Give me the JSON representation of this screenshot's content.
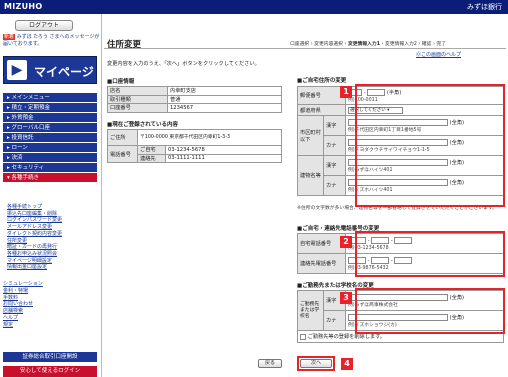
{
  "header": {
    "logo": "MIZUHO",
    "bank_name": "みずほ銀行"
  },
  "sidebar": {
    "logout_label": "ログアウト",
    "new_tag": "新着",
    "new_message": "みずほ たろう さまへのメッセージが届いております。",
    "mypage_label": "マイページ",
    "menu": [
      "メインメニュー",
      "積立・定期預金",
      "外貨預金",
      "グローバル口座",
      "投資信託",
      "ローン",
      "決済",
      "セキュリティ",
      "各種手続き"
    ],
    "submenu": [
      "各種手続トップ",
      "振込先口座編集・削除",
      "ログインパスワード変更",
      "メールアドレス変更",
      "ダイレクト契約内容変更",
      "住所変更",
      "暗証・カードの再発行",
      "各種お申込み状況照会",
      "マイページ明細設定",
      "情報出金口座設定"
    ],
    "extra_links": [
      "シミュレーション",
      "金利・特場",
      "手数料",
      "お問い合わせ",
      "店舗検索",
      "ヘルプ",
      "規定"
    ],
    "securities_button": "証券総合取引口座開設",
    "red_button": "安心して使えるログイン"
  },
  "page": {
    "title": "住所変更",
    "breadcrumbs": [
      "口座選択",
      "変更内容選択",
      "変更情報入力1",
      "変更情報入力2",
      "確認",
      "完了"
    ],
    "help_link": "この画面のヘルプ",
    "intro": "変更内容を入力のうえ、「次へ」ボタンをクリックしてください。"
  },
  "account_info": {
    "heading": "■口座情報",
    "rows": [
      [
        "店名",
        "内幸町支店"
      ],
      [
        "取引種類",
        "普通"
      ],
      [
        "口座番号",
        "1234567"
      ]
    ]
  },
  "current_info": {
    "heading": "■現在ご登録されている内容",
    "address_label": "ご住所",
    "address_value": "〒100-0000 東京都千代田区内幸町1-3-3",
    "phone_label": "電話番号",
    "home_label": "ご自宅",
    "home_value": "03-1234-5678",
    "contact_label": "連絡先",
    "contact_value": "03-1111-1111"
  },
  "form": {
    "address_heading": "■ご自宅住所の変更",
    "postal_label": "郵便番号",
    "postal_halfwidth": "(半角)",
    "postal_example": "例)100-0011",
    "pref_label": "都道府県",
    "pref_select": "選択してください",
    "city_label": "市区町村以下",
    "kanji_label": "漢字",
    "kana_label": "カナ",
    "fullwidth": "(全角)",
    "city_kanji_example": "例)千代田区内幸町1丁目1番地5号",
    "city_kana_example": "例)チヨダクウチサイワイチョウ1-1-5",
    "building_label": "建物名等",
    "building_kanji_example": "例)みずほハイツ401",
    "building_kana_example": "例)ミズホハイツ401",
    "address_note": "※住所の文字数が多い場合、建物名等を一部省略して登録させていただくことがございます。",
    "phone_heading": "■ご自宅・連絡先電話番号の変更",
    "home_phone_label": "自宅電話番号",
    "home_phone_example": "例)03-1234-5678",
    "contact_phone_label": "連絡先電話番号",
    "contact_phone_example": "例)03-9876-5432",
    "work_heading": "■ご勤務先または学校名の変更",
    "work_label": "ご勤務先または学校名",
    "work_kanji_example": "例)みずほ商事株式会社",
    "work_kana_example": "例)ミズホショウジ(カ)",
    "delete_checkbox": "ご勤務先等の登録を削除します。"
  },
  "buttons": {
    "back": "戻る",
    "next": "次へ"
  },
  "badges": [
    "1",
    "2",
    "3",
    "4"
  ],
  "colors": {
    "navy": "#1c3796",
    "red": "#e8222a"
  }
}
